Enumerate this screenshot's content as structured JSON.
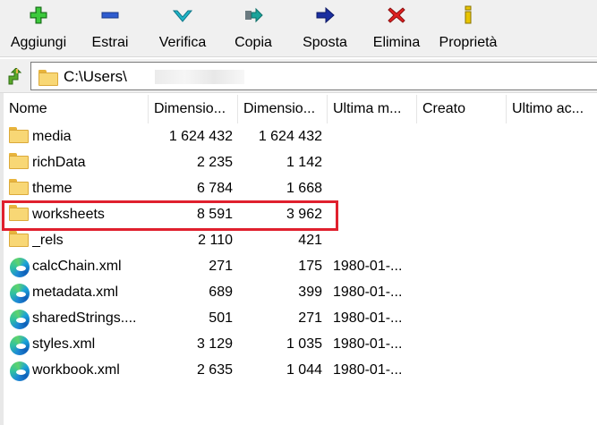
{
  "toolbar": {
    "buttons": [
      {
        "label": "Aggiungi",
        "icon": "add-plus-icon"
      },
      {
        "label": "Estrai",
        "icon": "extract-minus-icon"
      },
      {
        "label": "Verifica",
        "icon": "verify-check-icon"
      },
      {
        "label": "Copia",
        "icon": "copy-arrow-icon"
      },
      {
        "label": "Sposta",
        "icon": "move-arrow-icon"
      },
      {
        "label": "Elimina",
        "icon": "delete-x-icon"
      },
      {
        "label": "Proprietà",
        "icon": "info-icon"
      }
    ]
  },
  "address": {
    "path": "C:\\Users\\"
  },
  "columns": [
    "Nome",
    "Dimensio...",
    "Dimensio...",
    "Ultima m...",
    "Creato",
    "Ultimo ac..."
  ],
  "files": [
    {
      "name": "media",
      "type": "folder",
      "size": "1 624 432",
      "packed": "1 624 432",
      "modified": ""
    },
    {
      "name": "richData",
      "type": "folder",
      "size": "2 235",
      "packed": "1 142",
      "modified": ""
    },
    {
      "name": "theme",
      "type": "folder",
      "size": "6 784",
      "packed": "1 668",
      "modified": ""
    },
    {
      "name": "worksheets",
      "type": "folder",
      "size": "8 591",
      "packed": "3 962",
      "modified": ""
    },
    {
      "name": "_rels",
      "type": "folder",
      "size": "2 110",
      "packed": "421",
      "modified": ""
    },
    {
      "name": "calcChain.xml",
      "type": "xml",
      "size": "271",
      "packed": "175",
      "modified": "1980-01-..."
    },
    {
      "name": "metadata.xml",
      "type": "xml",
      "size": "689",
      "packed": "399",
      "modified": "1980-01-..."
    },
    {
      "name": "sharedStrings....",
      "type": "xml",
      "size": "501",
      "packed": "271",
      "modified": "1980-01-..."
    },
    {
      "name": "styles.xml",
      "type": "xml",
      "size": "3 129",
      "packed": "1 035",
      "modified": "1980-01-..."
    },
    {
      "name": "workbook.xml",
      "type": "xml",
      "size": "2 635",
      "packed": "1 044",
      "modified": "1980-01-..."
    }
  ],
  "highlighted": "worksheets",
  "colors": {
    "highlight": "#e0202e",
    "toolbar_bg": "#f0f0f0"
  }
}
